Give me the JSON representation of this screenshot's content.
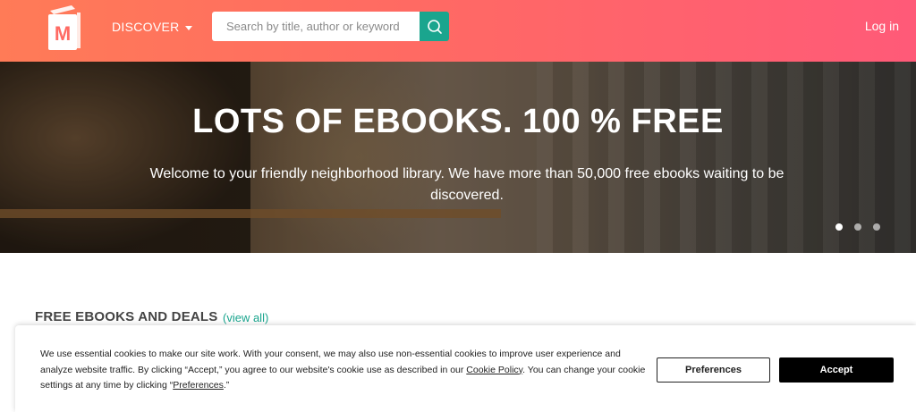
{
  "header": {
    "logo_letter": "M",
    "discover_label": "DISCOVER",
    "search_placeholder": "Search by title, author or keyword",
    "login_label": "Log in"
  },
  "hero": {
    "title": "LOTS OF EBOOKS. 100 % FREE",
    "subtitle": "Welcome to your friendly neighborhood library. We have more than 50,000 free ebooks waiting to be discovered.",
    "slides_count": 3,
    "active_slide": 1
  },
  "section": {
    "title": "FREE EBOOKS AND DEALS",
    "view_all": "(view all)"
  },
  "cookie_banner": {
    "text_part1": "We use essential cookies to make our site work. With your consent, we may also use non-essential cookies to improve user experience and analyze website traffic. By clicking “Accept,” you agree to our website's cookie use as described in our ",
    "cookie_policy_link": "Cookie Policy",
    "text_part2": ". You can change your cookie settings at any time by clicking “",
    "preferences_link": "Preferences",
    "text_part3": ".”",
    "preferences_button": "Preferences",
    "accept_button": "Accept"
  },
  "colors": {
    "header_gradient_start": "#ff7b57",
    "header_gradient_end": "#ff5a78",
    "accent_teal": "#1aa58e"
  },
  "icons": {
    "logo": "book-logo-icon",
    "search": "search-icon",
    "discover_caret": "caret-down-icon"
  }
}
